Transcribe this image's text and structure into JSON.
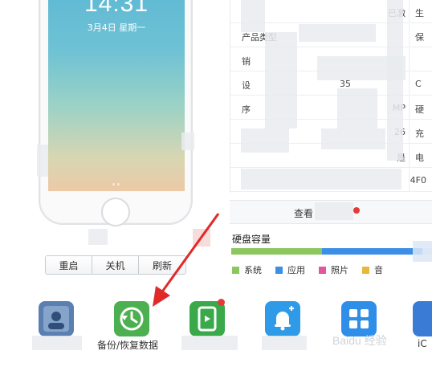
{
  "phone": {
    "time": "14:31",
    "date": "3月4日 星期一"
  },
  "phone_buttons": [
    {
      "label": "重启"
    },
    {
      "label": "关机"
    },
    {
      "label": "刷新"
    }
  ],
  "info_rows": [
    {
      "key": "",
      "value": "已激",
      "right": "生"
    },
    {
      "key": "产品类型",
      "value": "",
      "right": "保"
    },
    {
      "key": "销",
      "value": "",
      "right": ""
    },
    {
      "key": "设",
      "value": "35",
      "right": "C"
    },
    {
      "key": "序",
      "value": "MP",
      "right": "硬"
    },
    {
      "key": "",
      "value": "26",
      "right": "充"
    },
    {
      "key": "",
      "value": "是",
      "right": "电"
    },
    {
      "key": "",
      "value": "4F0",
      "right": ""
    }
  ],
  "view_button": {
    "label": "查看"
  },
  "disk": {
    "title": "硬盘容量",
    "segments": [
      {
        "name": "系统",
        "fraction": 0.45,
        "color": "#8cc65f"
      },
      {
        "name": "应用",
        "fraction": 0.5,
        "color": "#3d8ee6"
      }
    ],
    "legend": [
      {
        "label": "系统",
        "color": "#8cc65f"
      },
      {
        "label": "应用",
        "color": "#3d8ee6"
      },
      {
        "label": "照片",
        "color": "#e2579a"
      },
      {
        "label": "音",
        "color": "#e6b93a"
      }
    ]
  },
  "tools": [
    {
      "name": "",
      "label": "",
      "icon": "contacts-icon",
      "color": "#3e6fa8"
    },
    {
      "name": "backup",
      "label": "备份/恢复数据",
      "icon": "clock-restore-icon",
      "color": "#4caf50"
    },
    {
      "name": "",
      "label": "",
      "icon": "tablet-icon",
      "color": "#3aa94a"
    },
    {
      "name": "",
      "label": "",
      "icon": "bell-icon",
      "color": "#2f9be8"
    },
    {
      "name": "",
      "label": "",
      "icon": "apps-grid-icon",
      "color": "#2f8fe8"
    },
    {
      "name": "",
      "label": "iC",
      "icon": "app-icon",
      "color": "#3a7bd5"
    }
  ],
  "watermark": "Baidu 经验"
}
